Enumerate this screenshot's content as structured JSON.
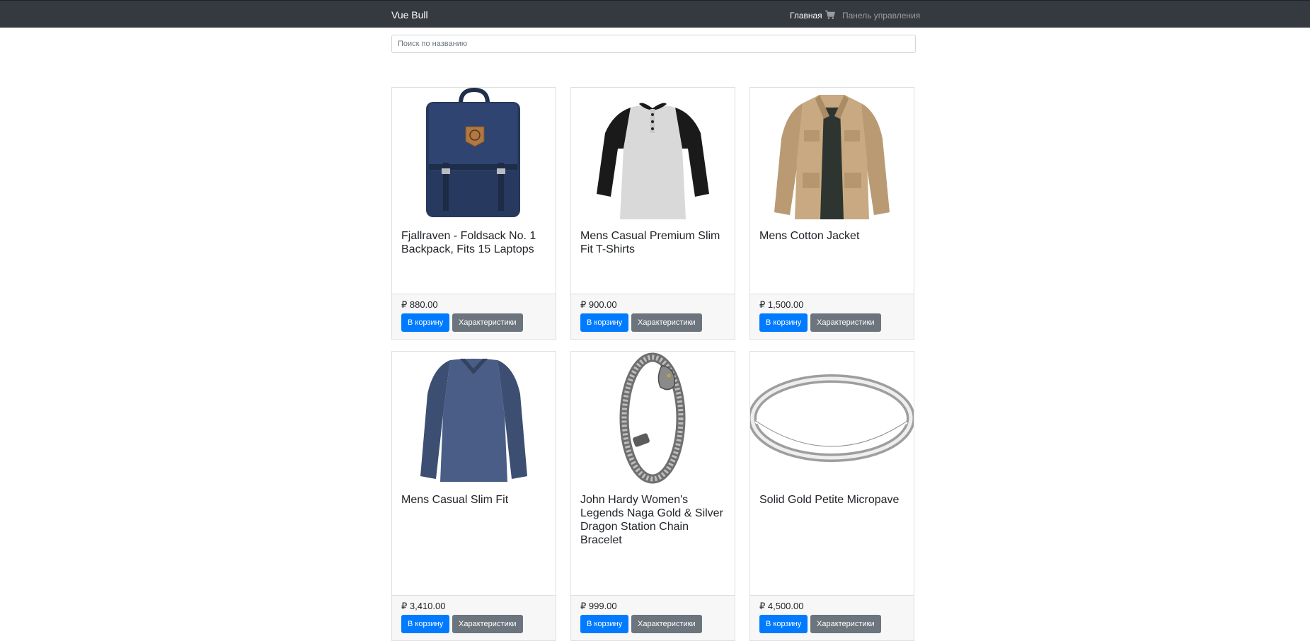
{
  "navbar": {
    "brand": "Vue Bull",
    "home_label": "Главная",
    "dashboard_label": "Панель управления",
    "cart_icon": "shopping-cart-icon"
  },
  "search": {
    "placeholder": "Поиск по названию",
    "value": ""
  },
  "products": [
    {
      "title": "Fjallraven - Foldsack No. 1 Backpack, Fits 15 Laptops",
      "price": "₽ 880.00",
      "cart_label": "В корзину",
      "specs_label": "Характеристики"
    },
    {
      "title": "Mens Casual Premium Slim Fit T-Shirts",
      "price": "₽ 900.00",
      "cart_label": "В корзину",
      "specs_label": "Характеристики"
    },
    {
      "title": "Mens Cotton Jacket",
      "price": "₽ 1,500.00",
      "cart_label": "В корзину",
      "specs_label": "Характеристики"
    },
    {
      "title": "Mens Casual Slim Fit",
      "price": "₽ 3,410.00",
      "cart_label": "В корзину",
      "specs_label": "Характеристики"
    },
    {
      "title": "John Hardy Women's Legends Naga Gold & Silver Dragon Station Chain Bracelet",
      "price": "₽ 999.00",
      "cart_label": "В корзину",
      "specs_label": "Характеристики"
    },
    {
      "title": "Solid Gold Petite Micropave",
      "price": "₽ 4,500.00",
      "cart_label": "В корзину",
      "specs_label": "Характеристики"
    }
  ],
  "colors": {
    "navbar_bg": "#343a40",
    "primary": "#007bff",
    "secondary": "#6c757d"
  }
}
